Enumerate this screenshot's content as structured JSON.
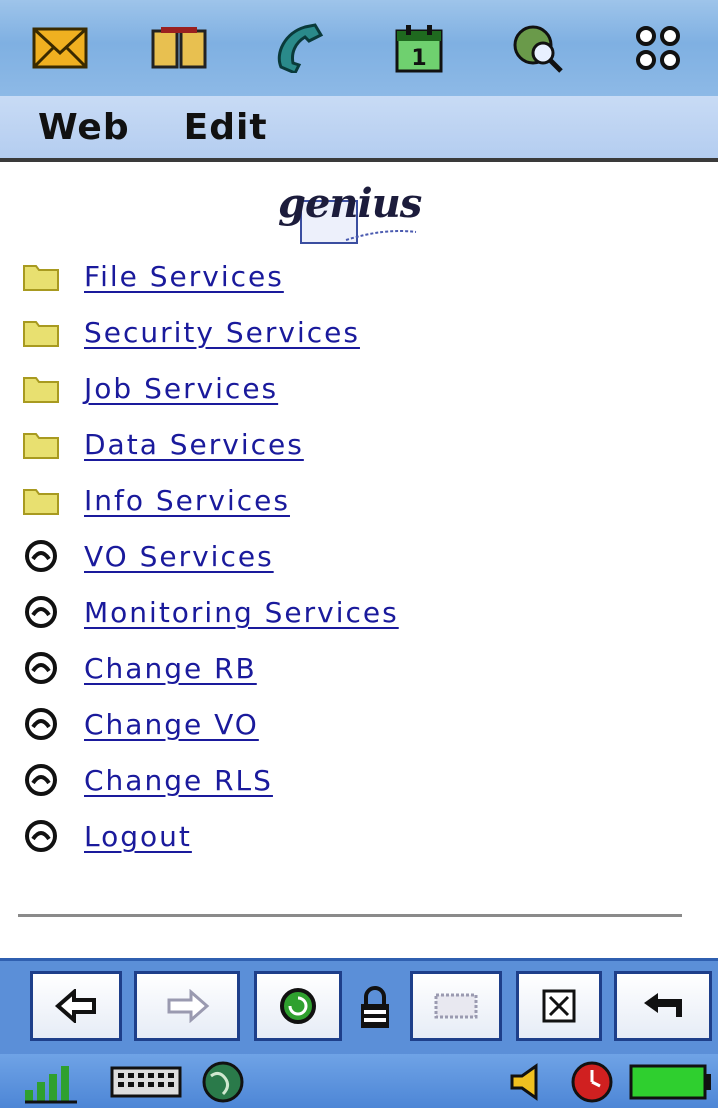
{
  "menubar": {
    "web": "Web",
    "edit": "Edit"
  },
  "logo": {
    "text": "genius"
  },
  "links": [
    {
      "label": "File Services",
      "icon": "folder-icon"
    },
    {
      "label": "Security Services",
      "icon": "folder-icon"
    },
    {
      "label": "Job Services",
      "icon": "folder-icon"
    },
    {
      "label": "Data Services",
      "icon": "folder-icon"
    },
    {
      "label": "Info Services",
      "icon": "folder-icon"
    },
    {
      "label": "VO Services",
      "icon": "link-bullet-icon"
    },
    {
      "label": "Monitoring Services",
      "icon": "link-bullet-icon"
    },
    {
      "label": "Change RB",
      "icon": "link-bullet-icon"
    },
    {
      "label": "Change VO",
      "icon": "link-bullet-icon"
    },
    {
      "label": "Change RLS",
      "icon": "link-bullet-icon"
    },
    {
      "label": "Logout",
      "icon": "link-bullet-icon"
    }
  ],
  "topbar_icons": [
    "mail-icon",
    "book-icon",
    "phone-icon",
    "calendar-icon",
    "globe-search-icon",
    "apps-grid-icon"
  ],
  "toolbar_icons": [
    "back-arrow-icon",
    "forward-arrow-icon",
    "reload-icon",
    "lock-icon",
    "stop-icon",
    "close-icon",
    "return-icon"
  ],
  "status_icons": [
    "signal-icon",
    "keyboard-icon",
    "globe-icon",
    "speaker-icon",
    "alarm-icon",
    "battery-icon"
  ],
  "colors": {
    "topbar": "#7fb0e2",
    "menubar": "#b4cdf0",
    "link": "#1a1a9c",
    "toolbar": "#5b8fd8"
  }
}
